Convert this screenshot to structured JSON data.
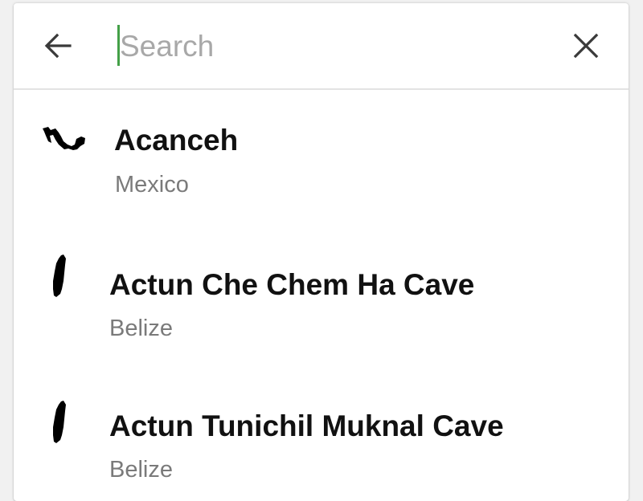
{
  "search": {
    "placeholder": "Search",
    "value": "",
    "accent_color": "#43a047",
    "back_icon": "arrow-left-icon",
    "clear_icon": "close-icon"
  },
  "results": [
    {
      "name": "Acanceh",
      "country": "Mexico",
      "icon": "mexico-map-icon"
    },
    {
      "name": "Actun Che Chem Ha Cave",
      "country": "Belize",
      "icon": "belize-map-icon"
    },
    {
      "name": "Actun Tunichil Muknal Cave",
      "country": "Belize",
      "icon": "belize-map-icon"
    }
  ]
}
